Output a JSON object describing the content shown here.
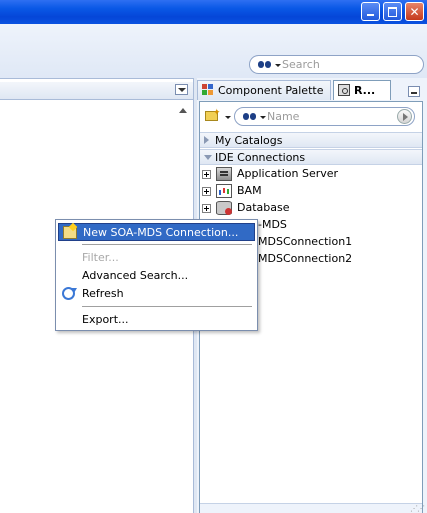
{
  "global_search": {
    "placeholder": "Search"
  },
  "tabs": [
    {
      "label": "Component Palette"
    },
    {
      "label": "R..."
    }
  ],
  "resources": {
    "name_filter_placeholder": "Name",
    "sections": [
      {
        "label": "My Catalogs",
        "expanded": false
      },
      {
        "label": "IDE Connections",
        "expanded": true
      }
    ],
    "tree": [
      {
        "label": "Application Server",
        "icon": "app-server-icon"
      },
      {
        "label": "BAM",
        "icon": "bam-icon"
      },
      {
        "label": "Database",
        "icon": "database-icon"
      }
    ],
    "mds_node": "-MDS",
    "mds_children": [
      "MDSConnection1",
      "MDSConnection2"
    ]
  },
  "context_menu": {
    "items": [
      {
        "label": "New SOA-MDS Connection...",
        "state": "highlighted"
      },
      {
        "label": "Filter...",
        "state": "disabled"
      },
      {
        "label": "Advanced Search...",
        "state": "normal"
      },
      {
        "label": "Refresh",
        "state": "normal"
      },
      {
        "label": "Export...",
        "state": "normal"
      }
    ]
  },
  "colors": {
    "titlebar": "#0a58e6",
    "menu_highlight": "#316ac5",
    "close_button": "#c5391c"
  }
}
